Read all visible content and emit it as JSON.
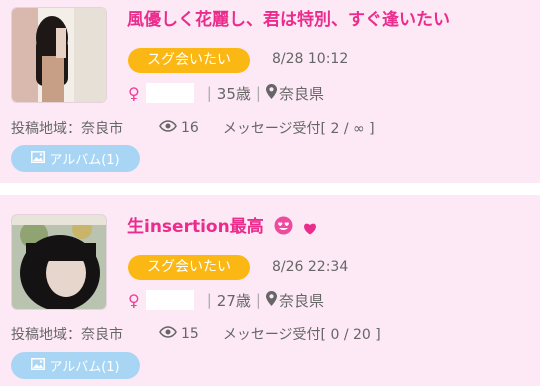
{
  "posts": [
    {
      "title": "風優しく花麗し、君は特別、すぐ逢いたい",
      "badge": "スグ会いたい",
      "time": "8/28 10:12",
      "gender_symbol": "♀",
      "age": "35歳",
      "prefecture": "奈良県",
      "area": "投稿地域：奈良市",
      "views": "16",
      "messages": "メッセージ受付[ 2 / ∞ ]",
      "album": "アルバム(1)"
    },
    {
      "title": "生insertion最高",
      "badge": "スグ会いたい",
      "time": "8/26 22:34",
      "gender_symbol": "♀",
      "age": "27歳",
      "prefecture": "奈良県",
      "area": "投稿地域：奈良市",
      "views": "15",
      "messages": "メッセージ受付[ 0 / 20 ]",
      "album": "アルバム(1)"
    }
  ],
  "colors": {
    "card_bg": "#fde9f5",
    "title": "#ec2c8c",
    "badge": "#fbb814",
    "album": "#a9d5f4"
  },
  "icons": [
    "eye-icon",
    "location-pin-icon",
    "image-icon",
    "heart-eyes-emoji-icon",
    "heart-icon"
  ]
}
